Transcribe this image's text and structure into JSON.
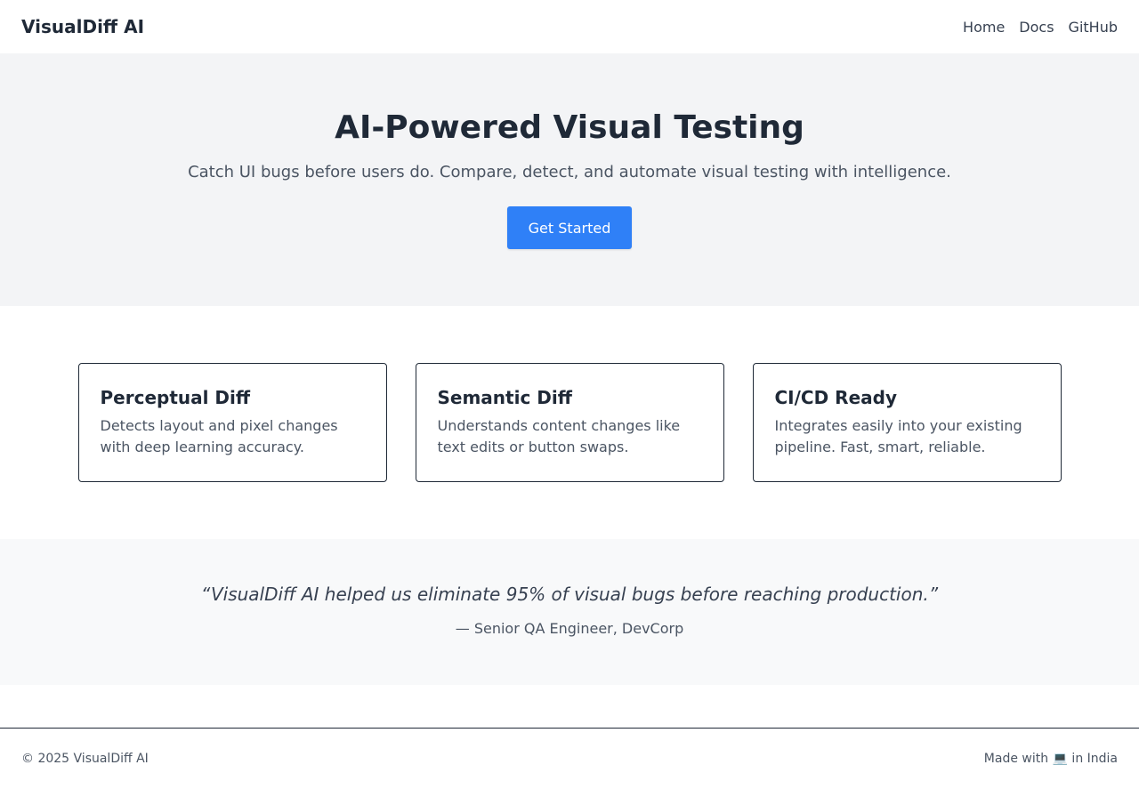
{
  "nav": {
    "brand": "VisualDiff AI",
    "links": [
      "Home",
      "Docs",
      "GitHub"
    ]
  },
  "hero": {
    "title": "AI-Powered Visual Testing",
    "subtitle": "Catch UI bugs before users do. Compare, detect, and automate visual testing with intelligence.",
    "cta_label": "Get Started",
    "cta_color": "#2f80f7"
  },
  "features": [
    {
      "title": "Perceptual Diff",
      "description": "Detects layout and pixel changes with deep learning accuracy."
    },
    {
      "title": "Semantic Diff",
      "description": "Understands content changes like text edits or button swaps."
    },
    {
      "title": "CI/CD Ready",
      "description": "Integrates easily into your existing pipeline. Fast, smart, reliable."
    }
  ],
  "testimonial": {
    "quote": "“VisualDiff AI helped us eliminate 95% of visual bugs before reaching production.”",
    "author": "— Senior QA Engineer, DevCorp"
  },
  "footer": {
    "copyright": "© 2025 VisualDiff AI",
    "made_with": "Made with 💻 in India"
  }
}
